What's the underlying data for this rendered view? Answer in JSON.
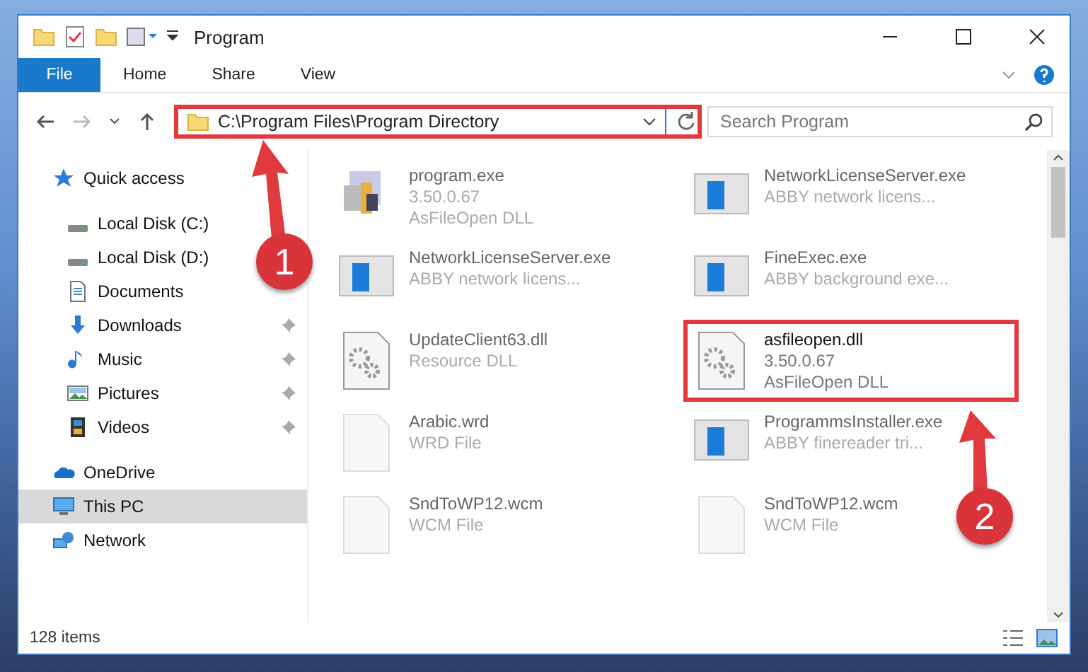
{
  "window": {
    "title": "Program"
  },
  "ribbon_tabs": [
    {
      "label": "File",
      "selected": true
    },
    {
      "label": "Home",
      "selected": false
    },
    {
      "label": "Share",
      "selected": false
    },
    {
      "label": "View",
      "selected": false
    }
  ],
  "address": {
    "path": "C:\\Program Files\\Program Directory",
    "highlighted": true
  },
  "search": {
    "placeholder": "Search Program"
  },
  "sidebar": {
    "items": [
      {
        "label": "Quick access",
        "kind": "star",
        "selected": false,
        "children": [
          {
            "label": "Local Disk (C:)",
            "kind": "disk",
            "pinned": false,
            "selected": false
          },
          {
            "label": "Local Disk (D:)",
            "kind": "disk",
            "pinned": false,
            "selected": false
          },
          {
            "label": "Documents",
            "kind": "document",
            "pinned": false,
            "selected": false
          },
          {
            "label": "Downloads",
            "kind": "download",
            "pinned": true,
            "selected": false
          },
          {
            "label": "Music",
            "kind": "music",
            "pinned": true,
            "selected": false
          },
          {
            "label": "Pictures",
            "kind": "pictures",
            "pinned": true,
            "selected": false
          },
          {
            "label": "Videos",
            "kind": "videos",
            "pinned": true,
            "selected": false
          }
        ]
      },
      {
        "label": "OneDrive",
        "kind": "cloud",
        "selected": false
      },
      {
        "label": "This PC",
        "kind": "pc",
        "selected": true
      },
      {
        "label": "Network",
        "kind": "network",
        "selected": false
      }
    ]
  },
  "files": [
    {
      "name": "program.exe",
      "details": [
        "3.50.0.67",
        "AsFileOpen DLL"
      ],
      "kind": "app",
      "highlighted": false
    },
    {
      "name": "NetworkLicenseServer.exe",
      "details": [
        "ABBY network licens..."
      ],
      "kind": "window",
      "highlighted": false
    },
    {
      "name": "NetworkLicenseServer.exe",
      "details": [
        "ABBY network licens..."
      ],
      "kind": "window",
      "highlighted": false
    },
    {
      "name": "FineExec.exe",
      "details": [
        "ABBY background exe..."
      ],
      "kind": "window",
      "highlighted": false
    },
    {
      "name": "UpdateClient63.dll",
      "details": [
        "Resource DLL"
      ],
      "kind": "dll",
      "highlighted": false
    },
    {
      "name": "asfileopen.dll",
      "details": [
        "3.50.0.67",
        "AsFileOpen DLL"
      ],
      "kind": "dll",
      "highlighted": true
    },
    {
      "name": "Arabic.wrd",
      "details": [
        "WRD File"
      ],
      "kind": "blank",
      "highlighted": false
    },
    {
      "name": "ProgrammsInstaller.exe",
      "details": [
        "ABBY finereader tri..."
      ],
      "kind": "window",
      "highlighted": false
    },
    {
      "name": "SndToWP12.wcm",
      "details": [
        "WCM File"
      ],
      "kind": "blank",
      "highlighted": false
    },
    {
      "name": "SndToWP12.wcm",
      "details": [
        "WCM File"
      ],
      "kind": "blank",
      "highlighted": false
    }
  ],
  "status_bar": {
    "count": "128 items"
  },
  "annotations": [
    {
      "label": "1"
    },
    {
      "label": "2"
    }
  ]
}
